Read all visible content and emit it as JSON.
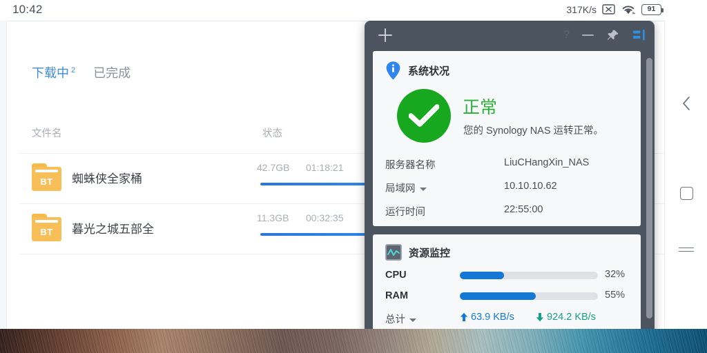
{
  "statusbar": {
    "clock": "10:42",
    "net_speed": "317K/s",
    "signal_icon": "no-sim-icon",
    "wifi_icon": "wifi-icon",
    "battery_icon": "battery-icon",
    "battery_level": "91"
  },
  "download_app": {
    "tabs": [
      {
        "label": "下载中",
        "badge": "2",
        "active": true
      },
      {
        "label": "已完成",
        "badge": "",
        "active": false
      }
    ],
    "columns": {
      "name": "文件名",
      "status": "状态"
    },
    "rows": [
      {
        "icon": "bt-folder-icon",
        "icon_text": "BT",
        "name": "蜘蛛侠全家桶",
        "size": "42.7GB",
        "eta": "01:18:21",
        "progress": 100
      },
      {
        "icon": "bt-folder-icon",
        "icon_text": "BT",
        "name": "暮光之城五部全",
        "size": "11.3GB",
        "eta": "00:32:35",
        "progress": 100
      }
    ]
  },
  "nas_window": {
    "titlebar": {
      "add_icon": "plus-icon",
      "help_icon": "help-icon",
      "help_label": "?",
      "minimize_icon": "minimize-icon",
      "pin_icon": "pin-icon",
      "panel_icon": "panel-toggle-icon"
    },
    "health_card": {
      "header_icon": "info-pin-icon",
      "header_title": "系统状况",
      "status_icon": "check-circle-icon",
      "status_title": "正常",
      "status_subtitle": "您的 Synology NAS 运转正常。",
      "rows": [
        {
          "label": "服务器名称",
          "value": "LiuCHangXin_NAS",
          "has_caret": false
        },
        {
          "label": "局域网",
          "value": "10.10.10.62",
          "has_caret": true
        },
        {
          "label": "运行时间",
          "value": "22:55:00",
          "has_caret": false
        }
      ]
    },
    "monitor_card": {
      "header_icon": "resource-monitor-icon",
      "header_title": "资源监控",
      "meters": [
        {
          "label": "CPU",
          "percent_label": "32%",
          "percent": 32
        },
        {
          "label": "RAM",
          "percent_label": "55%",
          "percent": 55
        }
      ],
      "traffic": {
        "label": "总计",
        "has_caret": true,
        "upload_icon": "arrow-up-icon",
        "upload": "63.9 KB/s",
        "download_icon": "arrow-down-icon",
        "download": "924.2 KB/s"
      }
    },
    "scrollbar": "vertical-scrollbar"
  },
  "navbar": {
    "back_icon": "back-chevron-icon",
    "home_icon": "home-square-icon",
    "recents_icon": "recents-menu-icon"
  },
  "colors": {
    "accent_blue": "#3c8dde",
    "progress_blue": "#2a78d8",
    "progress_cyan": "#19c0f5",
    "health_green": "#17a81f",
    "normal_green": "#2eae3a",
    "meter_blue": "#1478d4",
    "download_green": "#16a085",
    "window_chrome": "#4c545f",
    "bt_folder_orange": "#f8bf58"
  }
}
